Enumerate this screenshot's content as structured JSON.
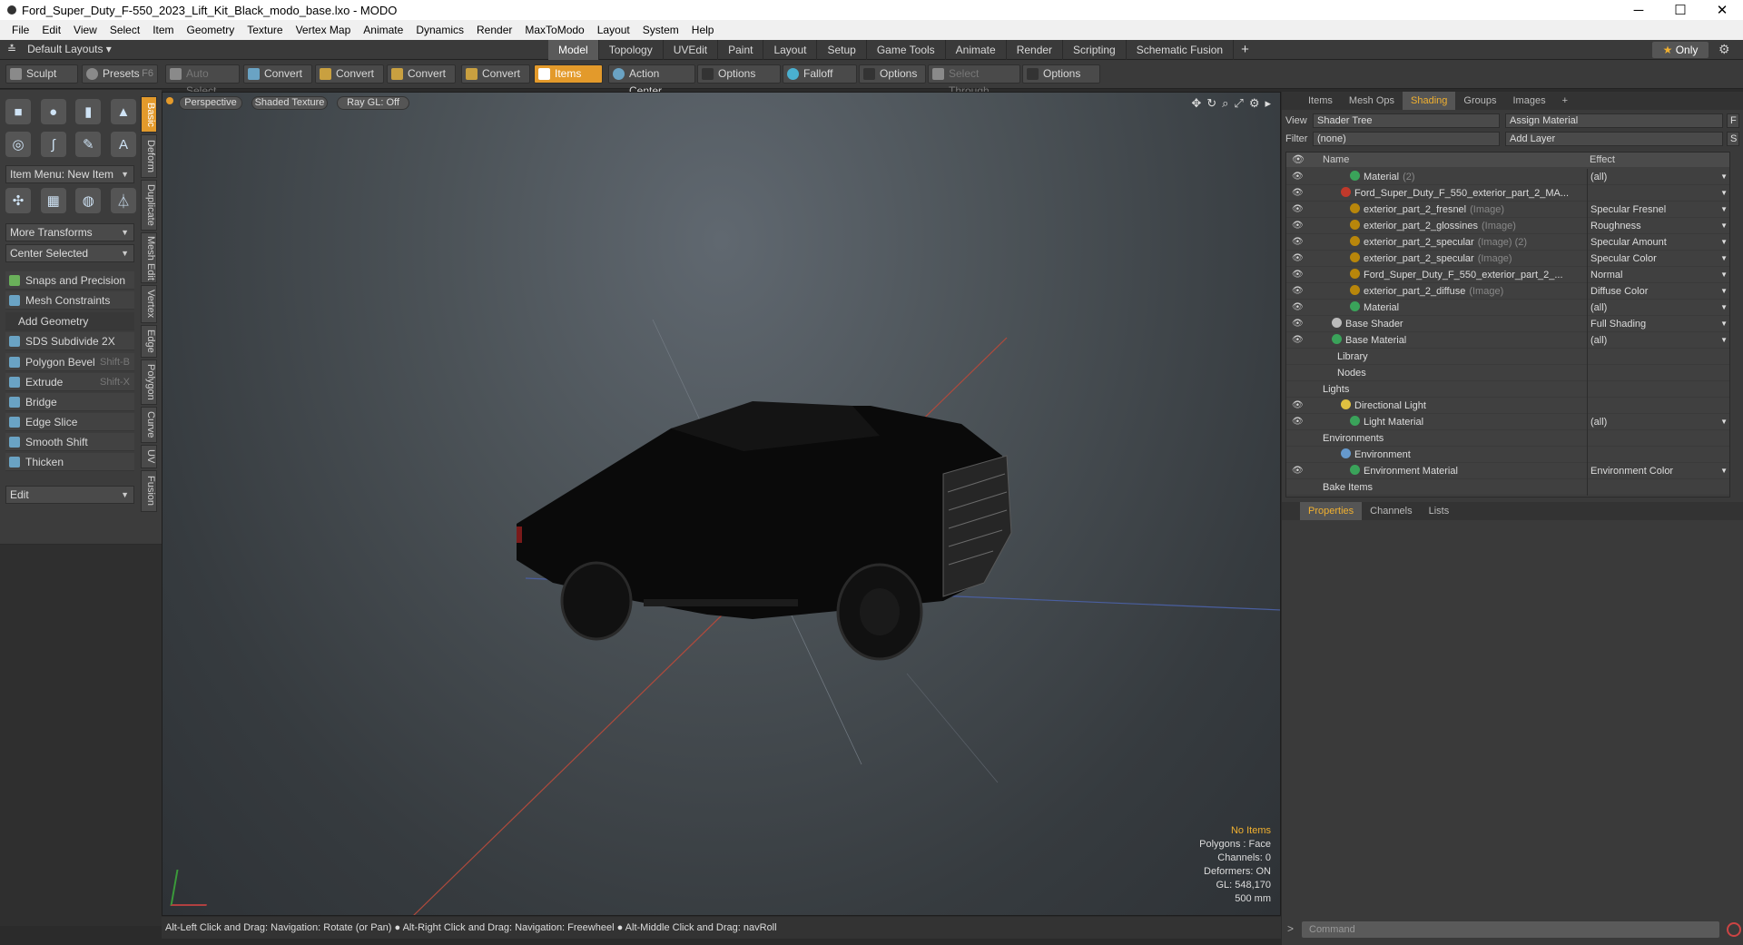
{
  "window": {
    "title": "Ford_Super_Duty_F-550_2023_Lift_Kit_Black_modo_base.lxo - MODO",
    "minimize": "─",
    "maximize": "☐",
    "close": "✕"
  },
  "menu": [
    "File",
    "Edit",
    "View",
    "Select",
    "Item",
    "Geometry",
    "Texture",
    "Vertex Map",
    "Animate",
    "Dynamics",
    "Render",
    "MaxToModo",
    "Layout",
    "System",
    "Help"
  ],
  "layoutbar": {
    "default_layouts": "Default Layouts ▾",
    "tabs": [
      "Model",
      "Topology",
      "UVEdit",
      "Paint",
      "Layout",
      "Setup",
      "Game Tools",
      "Animate",
      "Render",
      "Scripting",
      "Schematic Fusion"
    ],
    "active_tab": "Model",
    "plus": "+",
    "only": "Only",
    "only_star": "★",
    "gear": "⚙"
  },
  "toolbar": {
    "sculpt": "Sculpt",
    "presets": "Presets",
    "presets_key": "F6",
    "auto_select": "Auto Select",
    "convert1": "Convert",
    "convert2": "Convert",
    "convert3": "Convert",
    "convert4": "Convert",
    "items": "Items",
    "action_center": "Action Center",
    "options1": "Options",
    "falloff": "Falloff",
    "options2": "Options",
    "select_through": "Select Through",
    "options3": "Options"
  },
  "leftpanel": {
    "item_menu": "Item Menu: New Item",
    "more_transforms": "More Transforms",
    "center_selected": "Center Selected",
    "snaps": "Snaps and Precision",
    "mesh_constraints": "Mesh Constraints",
    "add_geometry": "Add Geometry",
    "tools": [
      {
        "label": "SDS Subdivide 2X",
        "key": ""
      },
      {
        "label": "Polygon Bevel",
        "key": "Shift-B"
      },
      {
        "label": "Extrude",
        "key": "Shift-X"
      },
      {
        "label": "Bridge",
        "key": ""
      },
      {
        "label": "Edge Slice",
        "key": ""
      },
      {
        "label": "Smooth Shift",
        "key": ""
      },
      {
        "label": "Thicken",
        "key": ""
      }
    ],
    "edit": "Edit",
    "side_tabs": [
      "Basic",
      "Deform",
      "Duplicate",
      "Mesh Edit",
      "Vertex",
      "Edge",
      "Polygon",
      "Curve",
      "UV",
      "Fusion"
    ]
  },
  "viewport": {
    "perspective": "Perspective",
    "shading": "Shaded Texture",
    "raygl": "Ray GL: Off",
    "stats": {
      "no_items": "No Items",
      "polygons": "Polygons : Face",
      "channels": "Channels: 0",
      "deformers": "Deformers: ON",
      "gl": "GL: 548,170",
      "scale": "500 mm"
    }
  },
  "statusbar": "Alt-Left Click and Drag: Navigation: Rotate (or Pan) ● Alt-Right Click and Drag: Navigation: Freewheel ● Alt-Middle Click and Drag: navRoll",
  "rightpanel": {
    "tabs": [
      "Items",
      "Mesh Ops",
      "Shading",
      "Groups",
      "Images"
    ],
    "active_tab": "Shading",
    "plus": "+",
    "view_label": "View",
    "view_value": "Shader Tree",
    "assign_material": "Assign Material",
    "f_btn": "F",
    "filter_label": "Filter",
    "filter_value": "(none)",
    "add_layer": "Add Layer",
    "s_btn": "S",
    "col_name": "Name",
    "col_effect": "Effect",
    "rows": [
      {
        "name": "Material",
        "type": "(2)",
        "effect": "(all)",
        "eye": true,
        "indent": 70,
        "bullet": "#3aa35a",
        "dd": true
      },
      {
        "name": "Ford_Super_Duty_F_550_exterior_part_2_MA...",
        "type": "",
        "effect": "",
        "eye": true,
        "indent": 60,
        "bullet": "#c0392b",
        "dd": true
      },
      {
        "name": "exterior_part_2_fresnel",
        "type": "(Image)",
        "effect": "Specular Fresnel",
        "eye": true,
        "indent": 70,
        "bullet": "#b8860b",
        "dd": true
      },
      {
        "name": "exterior_part_2_glossines",
        "type": "(Image)",
        "effect": "Roughness",
        "eye": true,
        "indent": 70,
        "bullet": "#b8860b",
        "dd": true
      },
      {
        "name": "exterior_part_2_specular",
        "type": "(Image) (2)",
        "effect": "Specular Amount",
        "eye": true,
        "indent": 70,
        "bullet": "#b8860b",
        "dd": true
      },
      {
        "name": "exterior_part_2_specular",
        "type": "(Image)",
        "effect": "Specular Color",
        "eye": true,
        "indent": 70,
        "bullet": "#b8860b",
        "dd": true
      },
      {
        "name": "Ford_Super_Duty_F_550_exterior_part_2_...",
        "type": "",
        "effect": "Normal",
        "eye": true,
        "indent": 70,
        "bullet": "#b8860b",
        "dd": true
      },
      {
        "name": "exterior_part_2_diffuse",
        "type": "(Image)",
        "effect": "Diffuse Color",
        "eye": true,
        "indent": 70,
        "bullet": "#b8860b",
        "dd": true
      },
      {
        "name": "Material",
        "type": "",
        "effect": "(all)",
        "eye": true,
        "indent": 70,
        "bullet": "#3aa35a",
        "dd": true
      },
      {
        "name": "Base Shader",
        "type": "",
        "effect": "Full Shading",
        "eye": true,
        "indent": 50,
        "bullet": "#bbbbbb",
        "dd": true
      },
      {
        "name": "Base Material",
        "type": "",
        "effect": "(all)",
        "eye": true,
        "indent": 50,
        "bullet": "#3aa35a",
        "dd": true
      },
      {
        "name": "Library",
        "type": "",
        "effect": "",
        "eye": false,
        "indent": 56,
        "bullet": "",
        "dd": false
      },
      {
        "name": "Nodes",
        "type": "",
        "effect": "",
        "eye": false,
        "indent": 56,
        "bullet": "",
        "dd": false
      },
      {
        "name": "Lights",
        "type": "",
        "effect": "",
        "eye": false,
        "indent": 40,
        "bullet": "",
        "dd": false
      },
      {
        "name": "Directional Light",
        "type": "",
        "effect": "",
        "eye": true,
        "indent": 60,
        "bullet": "#e0c040",
        "dd": false
      },
      {
        "name": "Light Material",
        "type": "",
        "effect": "(all)",
        "eye": true,
        "indent": 70,
        "bullet": "#3aa35a",
        "dd": true
      },
      {
        "name": "Environments",
        "type": "",
        "effect": "",
        "eye": false,
        "indent": 40,
        "bullet": "",
        "dd": false
      },
      {
        "name": "Environment",
        "type": "",
        "effect": "",
        "eye": false,
        "indent": 60,
        "bullet": "#6699cc",
        "dd": false
      },
      {
        "name": "Environment Material",
        "type": "",
        "effect": "Environment Color",
        "eye": true,
        "indent": 70,
        "bullet": "#3aa35a",
        "dd": true
      },
      {
        "name": "Bake Items",
        "type": "",
        "effect": "",
        "eye": false,
        "indent": 40,
        "bullet": "",
        "dd": false
      }
    ],
    "props_tabs": [
      "Properties",
      "Channels",
      "Lists"
    ],
    "props_active": "Properties",
    "command_placeholder": "Command",
    "cmd_arrow": ">"
  }
}
